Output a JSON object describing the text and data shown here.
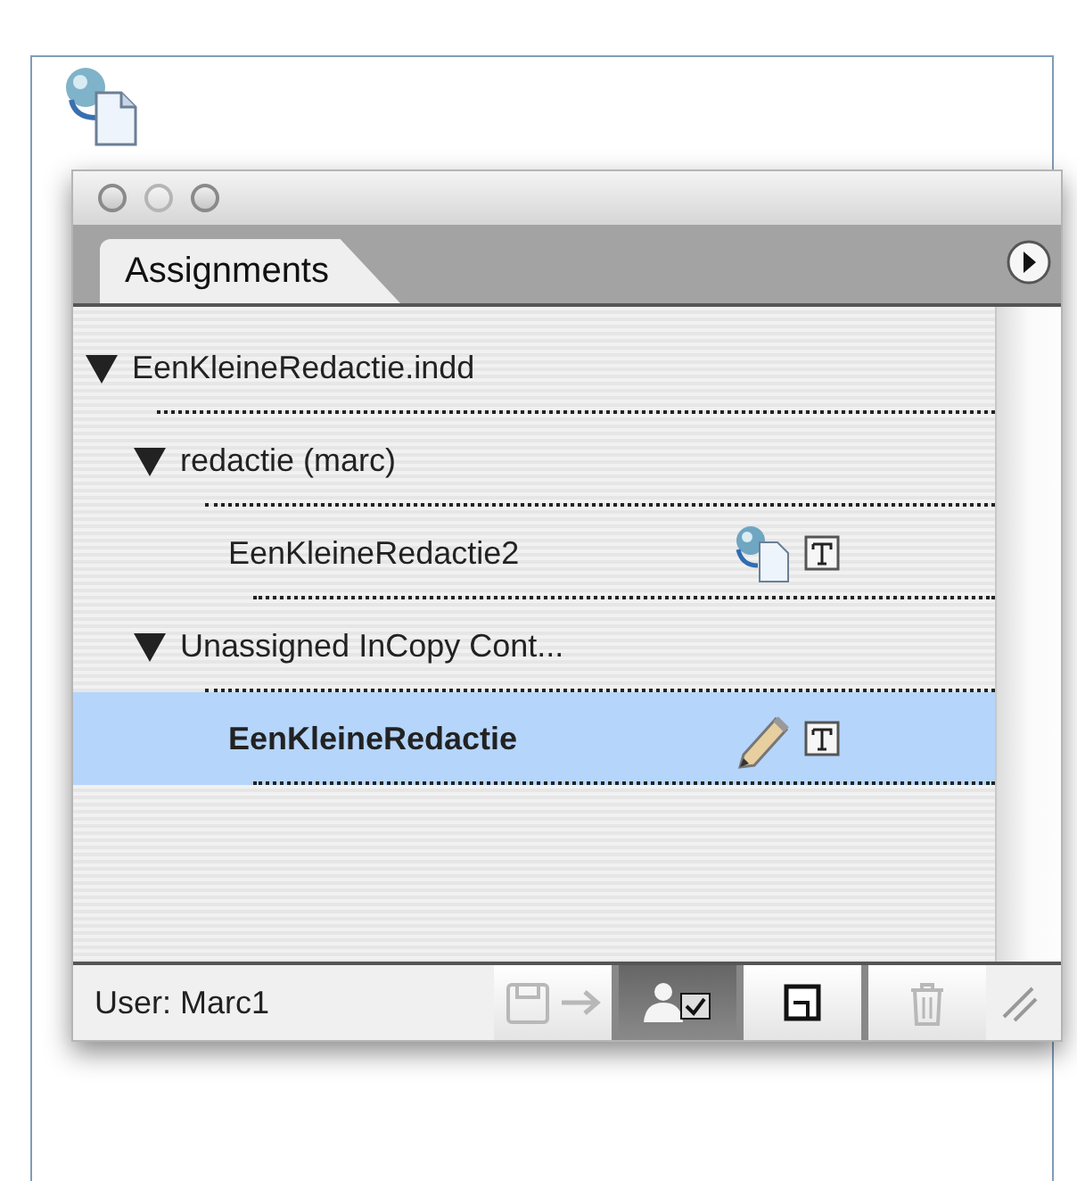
{
  "panel": {
    "tab": {
      "label": "Assignments",
      "selected": true
    },
    "tree": [
      {
        "label": "EenKleineRedactie.indd",
        "expanded": true,
        "selected": false,
        "children": [
          {
            "label": "redactie (marc)",
            "expanded": true,
            "selected": false,
            "children": [
              {
                "label": "EenKleineRedactie2",
                "selected": false,
                "kind": "linked"
              }
            ]
          },
          {
            "label": "Unassigned InCopy Cont...",
            "expanded": true,
            "selected": false,
            "children": [
              {
                "label": "EenKleineRedactie",
                "selected": true,
                "kind": "editing"
              }
            ]
          }
        ]
      }
    ],
    "user": "User: Marc1",
    "buttons": [
      {
        "kind": "update",
        "disabled": true,
        "pressed": false
      },
      {
        "kind": "assign",
        "disabled": false,
        "pressed": true
      },
      {
        "kind": "new",
        "disabled": false,
        "pressed": false
      },
      {
        "kind": "delete",
        "disabled": true,
        "pressed": false
      }
    ]
  }
}
